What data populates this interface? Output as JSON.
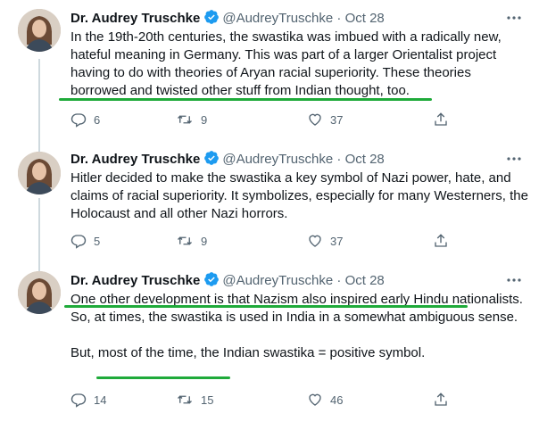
{
  "tweets": [
    {
      "name": "Dr. Audrey Truschke",
      "handle": "@AudreyTruschke",
      "dot": "·",
      "date": "Oct 28",
      "text": "In the 19th-20th centuries, the swastika was imbued with a radically new, hateful meaning in Germany. This was part of a larger Orientalist project having to do with theories of Aryan racial superiority. These theories borrowed and twisted other stuff from Indian thought, too.",
      "replies": "6",
      "retweets": "9",
      "likes": "37"
    },
    {
      "name": "Dr. Audrey Truschke",
      "handle": "@AudreyTruschke",
      "dot": "·",
      "date": "Oct 28",
      "text": "Hitler decided to make the swastika a key symbol of Nazi power, hate, and claims of racial superiority. It symbolizes, especially for many Westerners, the Holocaust and all other Nazi horrors.",
      "replies": "5",
      "retweets": "9",
      "likes": "37"
    },
    {
      "name": "Dr. Audrey Truschke",
      "handle": "@AudreyTruschke",
      "dot": "·",
      "date": "Oct 28",
      "text": "One other development is that Nazism also inspired early Hindu nationalists. So, at times, the swastika is used in India in a somewhat ambiguous sense.\n\nBut, most of the time, the Indian swastika = positive symbol.",
      "replies": "14",
      "retweets": "15",
      "likes": "46"
    }
  ],
  "colors": {
    "highlight": "#1faa3a",
    "verified": "#1d9bf0",
    "muted": "#536471"
  },
  "icons": [
    "verified-badge-icon",
    "more-icon",
    "reply-icon",
    "retweet-icon",
    "like-icon",
    "share-icon"
  ]
}
